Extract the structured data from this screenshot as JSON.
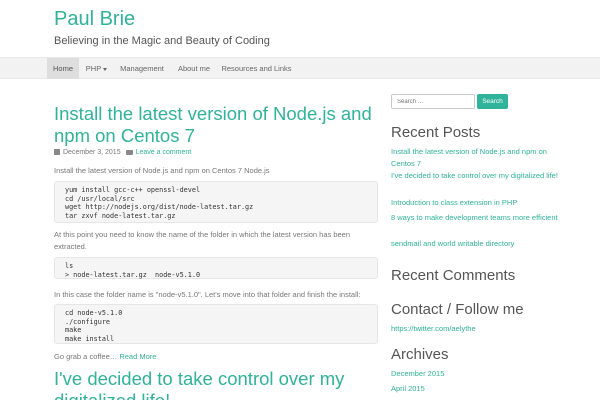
{
  "site": {
    "title": "Paul Brie",
    "tagline": "Believing in the Magic and Beauty of Coding"
  },
  "nav": {
    "items": [
      "Home",
      "PHP",
      "Management",
      "About me",
      "Resources and Links"
    ]
  },
  "post": {
    "title": "Install the latest version of Node.js and npm on Centos 7",
    "date": "December 3, 2015",
    "comment_link": "Leave a comment",
    "intro": "Install the latest version of Node.js and npm on Centos 7 Node.js",
    "code1": "yum install gcc-c++ openssl-devel\ncd /usr/local/src\nwget http://nodejs.org/dist/node-latest.tar.gz\ntar zxvf node-latest.tar.gz",
    "para2": "At this point you need to know the name of the folder in which the latest version has been extracted.",
    "code2": "ls\n> node-latest.tar.gz  node-v5.1.0",
    "para3": "In this case the folder name is \"node-v5.1.0\". Let's move into that folder and finish the install:",
    "code3": "cd node-v5.1.0\n./configure\nmake\nmake install",
    "closing": "Go grab a coffee… ",
    "read_more": "Read More"
  },
  "next_post": {
    "title": "I've decided to take control over my digitalized life!"
  },
  "sidebar": {
    "search_placeholder": "Search …",
    "search_button": "Search",
    "recent_posts_title": "Recent Posts",
    "recent_posts": [
      "Install the latest version of Node.js and npm on Centos 7",
      "I've decided to take control over my digitalized life!",
      "Introduction to class extension in PHP",
      "8 ways to make development teams more efficient",
      "sendmail and world writable directory"
    ],
    "recent_comments_title": "Recent Comments",
    "contact_title": "Contact / Follow me",
    "contact_link": "https://twitter.com/aelythe",
    "archives_title": "Archives",
    "archives": [
      "December 2015",
      "April 2015"
    ]
  },
  "colors": {
    "accent": "#2fb39a",
    "navbar": "#f2f2f2",
    "code_bg": "#f5f5f5"
  }
}
